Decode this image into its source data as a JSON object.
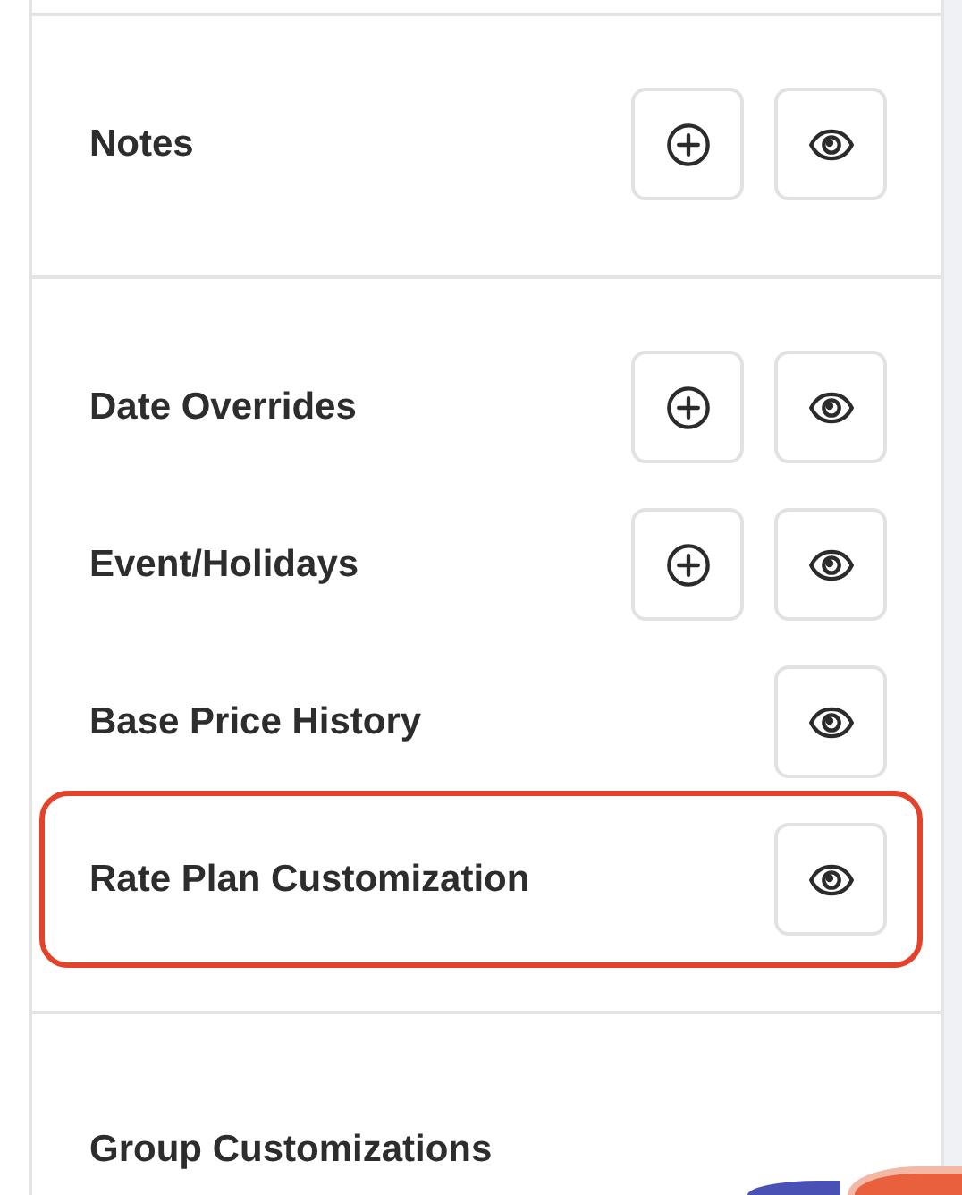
{
  "sections": [
    {
      "rows": [
        {
          "label": "Notes",
          "highlighted": false,
          "actions": [
            {
              "kind": "add"
            },
            {
              "kind": "view"
            }
          ]
        }
      ]
    },
    {
      "rows": [
        {
          "label": "Date Overrides",
          "highlighted": false,
          "actions": [
            {
              "kind": "add"
            },
            {
              "kind": "view"
            }
          ]
        },
        {
          "label": "Event/Holidays",
          "highlighted": false,
          "actions": [
            {
              "kind": "add"
            },
            {
              "kind": "view"
            }
          ]
        },
        {
          "label": "Base Price History",
          "highlighted": false,
          "actions": [
            {
              "kind": "view"
            }
          ]
        },
        {
          "label": "Rate Plan Customization",
          "highlighted": true,
          "actions": [
            {
              "kind": "view"
            }
          ]
        }
      ]
    },
    {
      "rows": [
        {
          "label": "Group Customizations",
          "highlighted": false,
          "actions": []
        }
      ]
    }
  ]
}
